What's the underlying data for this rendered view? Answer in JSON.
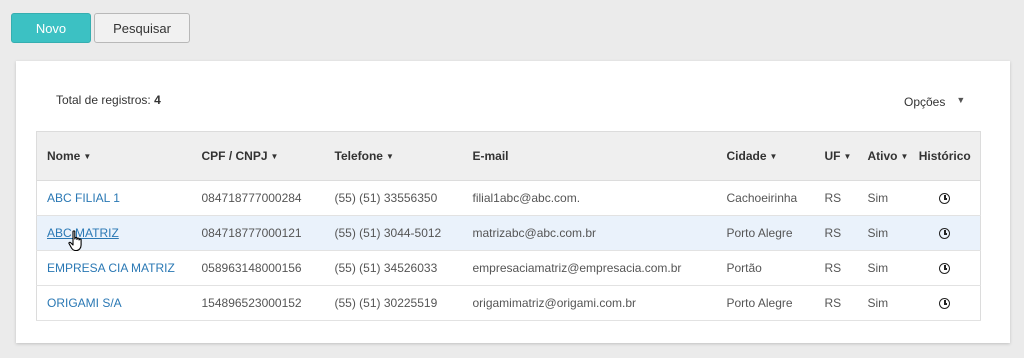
{
  "toolbar": {
    "new_label": "Novo",
    "search_label": "Pesquisar"
  },
  "summary": {
    "total_label": "Total de registros:",
    "total_value": "4"
  },
  "options": {
    "label": "Opções"
  },
  "table": {
    "headers": {
      "name": "Nome",
      "doc": "CPF / CNPJ",
      "phone": "Telefone",
      "email": "E-mail",
      "city": "Cidade",
      "uf": "UF",
      "active": "Ativo",
      "history": "Histórico"
    },
    "rows": [
      {
        "name": "ABC FILIAL 1",
        "doc": "084718777000284",
        "phone": "(55) (51) 33556350",
        "email": "filial1abc@abc.com.",
        "city": "Cachoeirinha",
        "uf": "RS",
        "active": "Sim"
      },
      {
        "name": "ABC MATRIZ",
        "doc": "084718777000121",
        "phone": "(55) (51) 3044-5012",
        "email": "matrizabc@abc.com.br",
        "city": "Porto Alegre",
        "uf": "RS",
        "active": "Sim"
      },
      {
        "name": "EMPRESA CIA MATRIZ",
        "doc": "058963148000156",
        "phone": "(55) (51) 34526033",
        "email": "empresaciamatriz@empresacia.com.br",
        "city": "Portão",
        "uf": "RS",
        "active": "Sim"
      },
      {
        "name": "ORIGAMI S/A",
        "doc": "154896523000152",
        "phone": "(55) (51) 30225519",
        "email": "origamimatriz@origami.com.br",
        "city": "Porto Alegre",
        "uf": "RS",
        "active": "Sim"
      }
    ]
  },
  "colors": {
    "primary": "#3cc1c3",
    "link": "#2a78b4",
    "row_hover": "#eaf2fb"
  }
}
